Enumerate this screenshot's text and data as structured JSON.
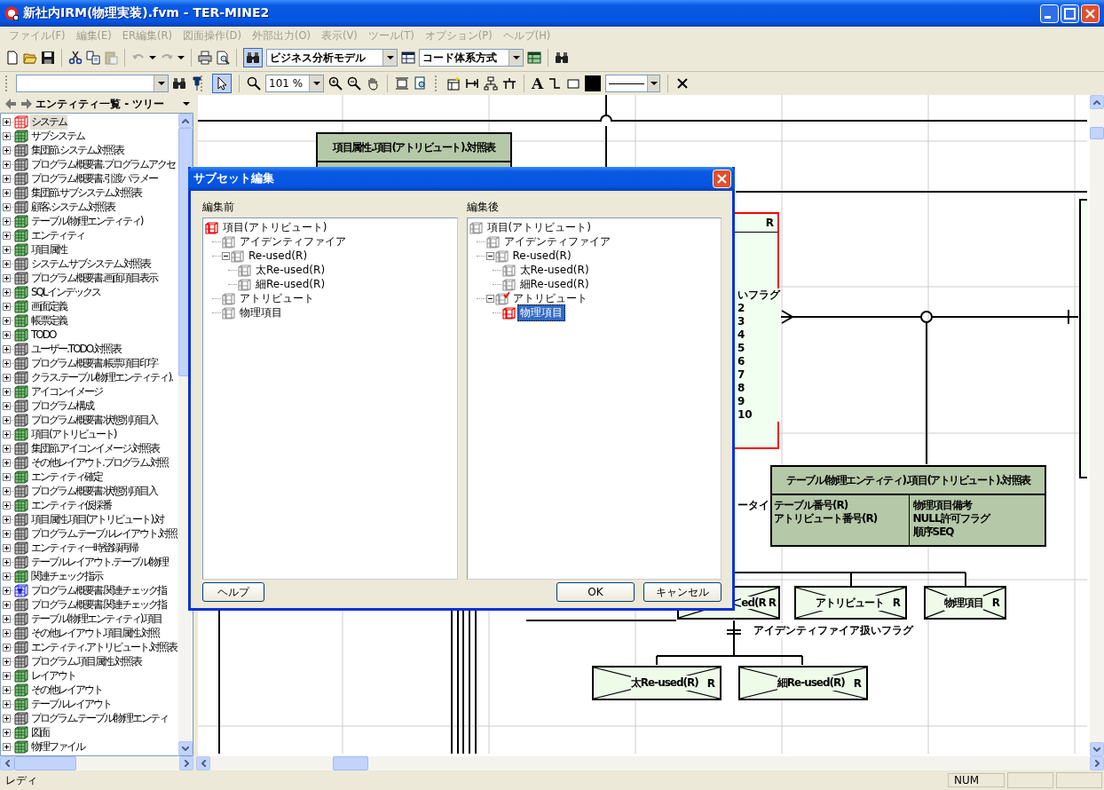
{
  "window": {
    "title": "新社内IRM(物理実装).fvm - TER-MINE2"
  },
  "menu": [
    {
      "label": "ファイル(F)",
      "disabled": true
    },
    {
      "label": "編集(E)",
      "disabled": true
    },
    {
      "label": "ER編集(R)",
      "disabled": true
    },
    {
      "label": "図面操作(D)",
      "disabled": true
    },
    {
      "label": "外部出力(O)",
      "disabled": true
    },
    {
      "label": "表示(V)",
      "disabled": true
    },
    {
      "label": "ツール(T)",
      "disabled": true
    },
    {
      "label": "オプション(P)",
      "disabled": true
    },
    {
      "label": "ヘルプ(H)",
      "disabled": true
    }
  ],
  "toolbar": {
    "model_combo": "ビジネス分析モデル",
    "code_combo": "コード体系方式"
  },
  "entity_panel": {
    "title": "エンティティ一覧 - ツリー",
    "items": [
      {
        "label": "システム",
        "kind": "red",
        "selected": true
      },
      {
        "label": "サブシステム",
        "kind": "green",
        "selected": false
      },
      {
        "label": "集団節.システム.対照表",
        "kind": "grey",
        "selected": false
      },
      {
        "label": "プログラム概要書.プログラムアクセ",
        "kind": "grey",
        "selected": false
      },
      {
        "label": "プログラム概要書.引渡パラメー",
        "kind": "grey",
        "selected": false
      },
      {
        "label": "集団節.サブシステム.対照表",
        "kind": "grey",
        "selected": false
      },
      {
        "label": "顧客.システム.対照表",
        "kind": "grey",
        "selected": false
      },
      {
        "label": "テーブル(物理エンティティ)",
        "kind": "green",
        "selected": false
      },
      {
        "label": "エンティティ",
        "kind": "green",
        "selected": false
      },
      {
        "label": "項目属性",
        "kind": "green",
        "selected": false
      },
      {
        "label": "システム.サブシステム.対照表",
        "kind": "grey",
        "selected": false
      },
      {
        "label": "プログラム概要書.画面項目表示",
        "kind": "grey",
        "selected": false
      },
      {
        "label": "SQLインデックス",
        "kind": "green",
        "selected": false
      },
      {
        "label": "画面定義",
        "kind": "green",
        "selected": false
      },
      {
        "label": "帳票定義",
        "kind": "green",
        "selected": false
      },
      {
        "label": "TODO",
        "kind": "green",
        "selected": false
      },
      {
        "label": "ユーザー.TODO.対照表",
        "kind": "grey",
        "selected": false
      },
      {
        "label": "プログラム概要書.帳票項目印字",
        "kind": "grey",
        "selected": false
      },
      {
        "label": "クラス.テーブル(物理エンティティ).",
        "kind": "grey",
        "selected": false
      },
      {
        "label": "アイコンイメージ",
        "kind": "green",
        "selected": false
      },
      {
        "label": "プログラム構成",
        "kind": "grey",
        "selected": false
      },
      {
        "label": "プログラム概要書.状態別項目入",
        "kind": "grey",
        "selected": false
      },
      {
        "label": "項目(アトリビュート)",
        "kind": "green",
        "selected": false
      },
      {
        "label": "集団節.アイコンイメージ.対照表",
        "kind": "grey",
        "selected": false
      },
      {
        "label": "その他レイアウト.プログラム.対照",
        "kind": "grey",
        "selected": false
      },
      {
        "label": "エンティティ確定",
        "kind": "green",
        "selected": false
      },
      {
        "label": "プログラム概要書.状態別項目入",
        "kind": "grey",
        "selected": false
      },
      {
        "label": "エンティティ仮採番",
        "kind": "green",
        "selected": false
      },
      {
        "label": "項目属性.項目(アトリビュート).対",
        "kind": "grey",
        "selected": false
      },
      {
        "label": "プログラム.テーブルレイアウト.対照",
        "kind": "grey",
        "selected": false
      },
      {
        "label": "エンティティ一時登録再帰",
        "kind": "grey",
        "selected": false
      },
      {
        "label": "テーブルレイアウト.テーブル(物理",
        "kind": "grey",
        "selected": false
      },
      {
        "label": "関連チェック指示",
        "kind": "green",
        "selected": false
      },
      {
        "label": "プログラム概要書.関連チェック指",
        "kind": "view",
        "selected": false
      },
      {
        "label": "プログラム概要書.関連チェック指",
        "kind": "grey",
        "selected": false
      },
      {
        "label": "テーブル(物理エンティティ).項目",
        "kind": "grey",
        "selected": false
      },
      {
        "label": "その他レイアウト.項目属性.対照",
        "kind": "grey",
        "selected": false
      },
      {
        "label": "エンティティ.アトリビュート.対照表",
        "kind": "grey",
        "selected": false
      },
      {
        "label": "プログラム.項目属性.対照表",
        "kind": "grey",
        "selected": false
      },
      {
        "label": "レイアウト",
        "kind": "green",
        "selected": false
      },
      {
        "label": "その他レイアウト",
        "kind": "green",
        "selected": false
      },
      {
        "label": "テーブルレイアウト",
        "kind": "green",
        "selected": false
      },
      {
        "label": "プログラム.テーブル(物理エンティ",
        "kind": "grey",
        "selected": false
      },
      {
        "label": "図面",
        "kind": "green",
        "selected": false
      },
      {
        "label": "物理ファイル",
        "kind": "green",
        "selected": false
      }
    ]
  },
  "diagram_toolbar": {
    "zoom": "101 %",
    "text_tool": "A"
  },
  "diagram": {
    "entities": [
      {
        "header": "項目属性.項目(アトリビュート).対照表",
        "highlighted": false
      },
      {
        "badge": "R",
        "lines": [
          "いフラグ",
          "2",
          "3",
          "4",
          "5",
          "6",
          "7",
          "8",
          "9",
          "10"
        ],
        "highlighted": true
      },
      {
        "header": "テーブル(物理エンティティ).項目(アトリビュート).対照表",
        "keys": [
          "テーブル番号(R)",
          "アトリビュート番号(R)"
        ],
        "attributes": [
          "物理項目備考",
          "NULL許可フラグ",
          "順序SEQ"
        ],
        "highlighted": false
      }
    ],
    "subtypes": [
      {
        "label": "ed(R",
        "badge": "R"
      },
      {
        "label": "アトリビュート",
        "badge": "R"
      },
      {
        "label": "物理項目",
        "badge": "R"
      },
      {
        "label": "太Re-used(R)",
        "badge": "R"
      },
      {
        "label": "細Re-used(R)",
        "badge": "R"
      }
    ],
    "labels": [
      "ータイ",
      "アイデンティファイア扱いフラグ"
    ]
  },
  "dialog": {
    "title": "サブセット編集",
    "before": {
      "label": "編集前",
      "tree": [
        {
          "label": "項目(アトリビュート)",
          "kind": "red",
          "selected": false,
          "children": [
            {
              "label": "アイデンティファイア",
              "kind": "plain",
              "selected": false
            },
            {
              "label": "Re-used(R)",
              "kind": "plain",
              "selected": false,
              "expanded": true,
              "children": [
                {
                  "label": "太Re-used(R)",
                  "kind": "plain",
                  "selected": false
                },
                {
                  "label": "細Re-used(R)",
                  "kind": "plain",
                  "selected": false
                }
              ]
            },
            {
              "label": "アトリビュート",
              "kind": "plain",
              "selected": false
            },
            {
              "label": "物理項目",
              "kind": "plain",
              "selected": false
            }
          ]
        }
      ]
    },
    "after": {
      "label": "編集後",
      "tree": [
        {
          "label": "項目(アトリビュート)",
          "kind": "plain",
          "selected": false,
          "children": [
            {
              "label": "アイデンティファイア",
              "kind": "plain",
              "selected": false
            },
            {
              "label": "Re-used(R)",
              "kind": "plain",
              "selected": false,
              "expanded": true,
              "children": [
                {
                  "label": "太Re-used(R)",
                  "kind": "plain",
                  "selected": false
                },
                {
                  "label": "細Re-used(R)",
                  "kind": "plain",
                  "selected": false
                }
              ]
            },
            {
              "label": "アトリビュート",
              "kind": "ticked",
              "selected": false,
              "expanded": true,
              "children": [
                {
                  "label": "物理項目",
                  "kind": "red",
                  "selected": true
                }
              ]
            }
          ]
        }
      ]
    },
    "buttons": [
      {
        "label": "ヘルプ"
      },
      {
        "label": "OK"
      },
      {
        "label": "キャンセル"
      }
    ]
  },
  "status_bar": {
    "text": "レディ",
    "num": "NUM"
  }
}
